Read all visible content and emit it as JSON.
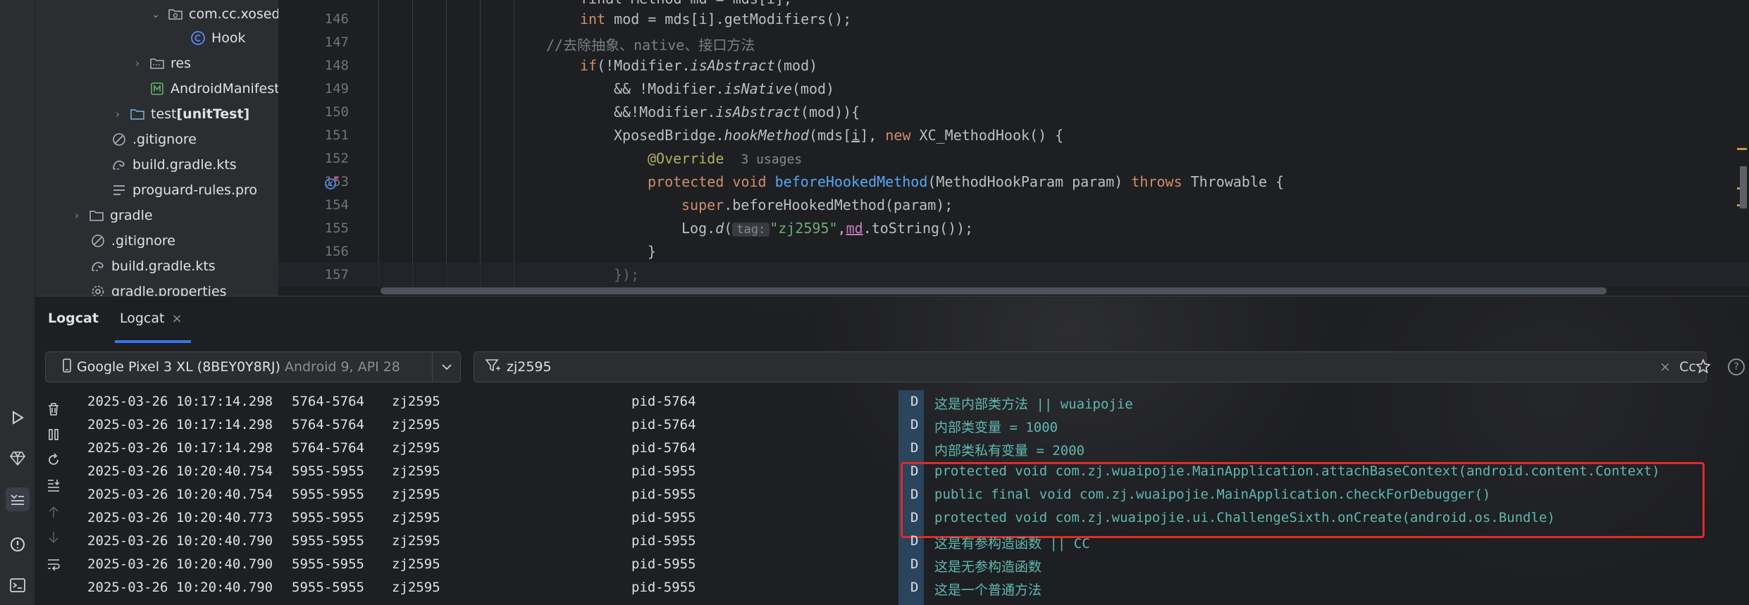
{
  "project_tree": {
    "items": [
      {
        "label": "com.cc.xosedd",
        "icon": "package-icon",
        "expanded": true
      },
      {
        "label": "Hook",
        "icon": "class-icon"
      },
      {
        "label": "res",
        "icon": "folder-icon",
        "expanded": false
      },
      {
        "label": "AndroidManifest.",
        "icon": "manifest-icon"
      },
      {
        "label_prefix": "test ",
        "label_bold": "[unitTest]",
        "icon": "folder-icon",
        "expanded": false
      },
      {
        "label": ".gitignore",
        "icon": "ignore-icon"
      },
      {
        "label": "build.gradle.kts",
        "icon": "gradle-icon"
      },
      {
        "label": "proguard-rules.pro",
        "icon": "text-file-icon"
      },
      {
        "label": "gradle",
        "icon": "folder-icon",
        "expanded": false
      },
      {
        "label": ".gitignore",
        "icon": "ignore-icon"
      },
      {
        "label": "build.gradle.kts",
        "icon": "gradle-icon"
      },
      {
        "label": "gradle.properties",
        "icon": "settings-file-icon"
      }
    ]
  },
  "editor": {
    "line_numbers": [
      "146",
      "147",
      "148",
      "149",
      "150",
      "151",
      "152",
      "153",
      "154",
      "155",
      "156",
      "157"
    ],
    "lines": {
      "l146": {
        "kw": "int",
        "rest": " mod = mds[i].getModifiers();"
      },
      "l147": {
        "comment": "//去除抽象、native、接口方法"
      },
      "l148": {
        "kw": "if",
        "a": "(!Modifier.",
        "it": "isAbstract",
        "b": "(mod)"
      },
      "l149": {
        "a": "&& !Modifier.",
        "it": "isNative",
        "b": "(mod)"
      },
      "l150": {
        "a": "&&!Modifier.",
        "it": "isAbstract",
        "b": "(mod)){"
      },
      "l151": {
        "a": "XposedBridge.",
        "it": "hookMethod",
        "b": "(mds[",
        "i": "i",
        "c": "], ",
        "kw": "new",
        "d": " XC_MethodHook() {"
      },
      "l152": {
        "ann": "@Override",
        "usage": "3 usages"
      },
      "l153": {
        "kw1": "protected",
        "kw2": "void",
        "fn": "beforeHookedMethod",
        "a": "(MethodHookParam param) ",
        "kw3": "throws",
        "b": " Throwable {"
      },
      "l154": {
        "kw": "super",
        "a": ".beforeHookedMethod(param);"
      },
      "l155": {
        "a": "Log.",
        "it": "d",
        "hint": "tag:",
        "str": "\"zj2595\"",
        "c": ",",
        "var": "md",
        "d": ".toString());"
      },
      "l156": {
        "a": "}"
      },
      "l157": {
        "a": "});"
      }
    },
    "truncated_top": "final Method md = mds[i];"
  },
  "logcat": {
    "tabs": [
      {
        "label": "Logcat"
      },
      {
        "label": "Logcat"
      }
    ],
    "device": {
      "name": "Google Pixel 3 XL (8BEY0Y8RJ)",
      "sub": "Android 9, API 28"
    },
    "filter": {
      "value": "zj2595",
      "case_label": "Cc"
    },
    "rows": [
      {
        "time": "2025-03-26 10:17:14.298",
        "pid": "5764-5764",
        "tag": "zj2595",
        "proc": "pid-5764",
        "level": "D",
        "msg": "这是内部类方法 || wuaipojie"
      },
      {
        "time": "2025-03-26 10:17:14.298",
        "pid": "5764-5764",
        "tag": "zj2595",
        "proc": "pid-5764",
        "level": "D",
        "msg": "内部类变量 = 1000"
      },
      {
        "time": "2025-03-26 10:17:14.298",
        "pid": "5764-5764",
        "tag": "zj2595",
        "proc": "pid-5764",
        "level": "D",
        "msg": "内部类私有变量 = 2000"
      },
      {
        "time": "2025-03-26 10:20:40.754",
        "pid": "5955-5955",
        "tag": "zj2595",
        "proc": "pid-5955",
        "level": "D",
        "msg": "protected void com.zj.wuaipojie.MainApplication.attachBaseContext(android.content.Context)"
      },
      {
        "time": "2025-03-26 10:20:40.754",
        "pid": "5955-5955",
        "tag": "zj2595",
        "proc": "pid-5955",
        "level": "D",
        "msg": "public final void com.zj.wuaipojie.MainApplication.checkForDebugger()"
      },
      {
        "time": "2025-03-26 10:20:40.773",
        "pid": "5955-5955",
        "tag": "zj2595",
        "proc": "pid-5955",
        "level": "D",
        "msg": "protected void com.zj.wuaipojie.ui.ChallengeSixth.onCreate(android.os.Bundle)"
      },
      {
        "time": "2025-03-26 10:20:40.790",
        "pid": "5955-5955",
        "tag": "zj2595",
        "proc": "pid-5955",
        "level": "D",
        "msg": "这是有参构造函数 || CC"
      },
      {
        "time": "2025-03-26 10:20:40.790",
        "pid": "5955-5955",
        "tag": "zj2595",
        "proc": "pid-5955",
        "level": "D",
        "msg": "这是无参构造函数"
      },
      {
        "time": "2025-03-26 10:20:40.790",
        "pid": "5955-5955",
        "tag": "zj2595",
        "proc": "pid-5955",
        "level": "D",
        "msg": "这是一个普通方法"
      }
    ]
  },
  "colors": {
    "accent": "#3574f0",
    "highlight_box": "#e02a2a",
    "log_message": "#5fb8b1",
    "level_column": "#2d4b67"
  }
}
